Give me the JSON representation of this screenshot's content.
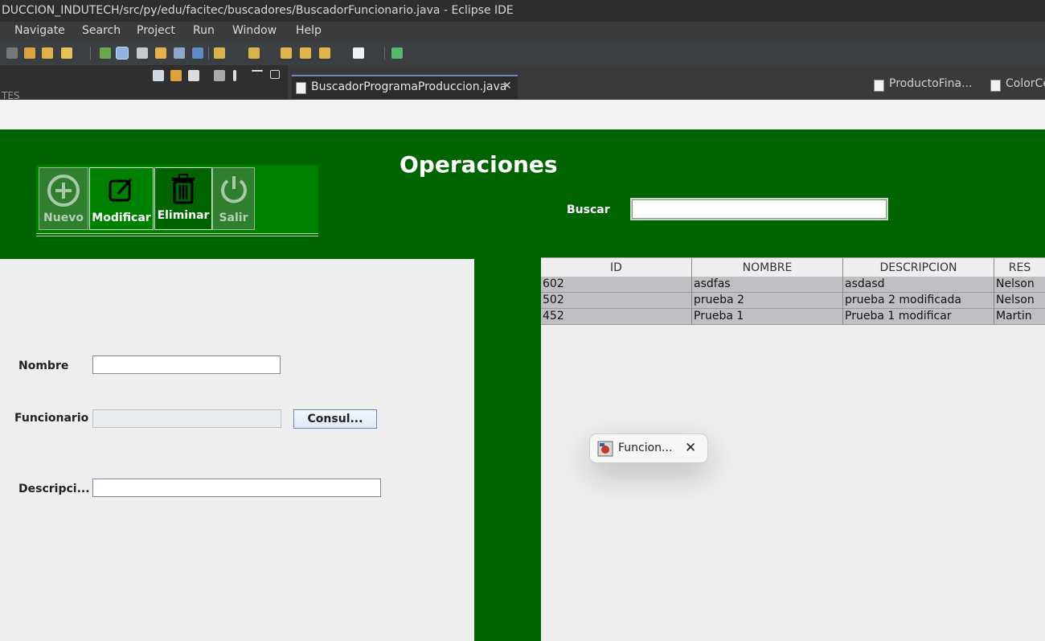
{
  "window": {
    "title": "DUCCION_INDUTECH/src/py/edu/facitec/buscadores/BuscadorFuncionario.java - Eclipse IDE"
  },
  "menu": [
    "Navigate",
    "Search",
    "Project",
    "Run",
    "Window",
    "Help"
  ],
  "views": {
    "left_tab_text": "TES",
    "editor_tab": "BuscadorProgramaProduccion.java",
    "right_tabs": [
      "ProductoFina...",
      "ColorCe"
    ]
  },
  "app": {
    "title": "Operaciones",
    "toolbar": {
      "nuevo": "Nuevo",
      "modificar": "Modificar",
      "eliminar": "Eliminar",
      "salir": "Salir"
    },
    "search": {
      "label": "Buscar",
      "value": ""
    },
    "form": {
      "nombre_label": "Nombre",
      "nombre_value": "",
      "funcionario_label": "Funcionario",
      "funcionario_value": "",
      "consultar_button": "Consul...",
      "descripcion_label": "Descripci...",
      "descripcion_value": ""
    },
    "table": {
      "headers": [
        "ID",
        "NOMBRE",
        "DESCRIPCION",
        "RES"
      ],
      "rows": [
        [
          "602",
          "asdfas",
          "asdasd",
          "Nelson"
        ],
        [
          "502",
          "prueba 2",
          "prueba 2 modificada",
          "Nelson"
        ],
        [
          "452",
          "Prueba 1",
          "Prueba 1 modificar",
          "Martin"
        ]
      ]
    }
  },
  "taskbar_preview": {
    "label": "Funcion..."
  },
  "colors": {
    "header_green": "#006400",
    "button_panel_green": "#008000",
    "eclipse_dark": "#2e2e2e"
  }
}
